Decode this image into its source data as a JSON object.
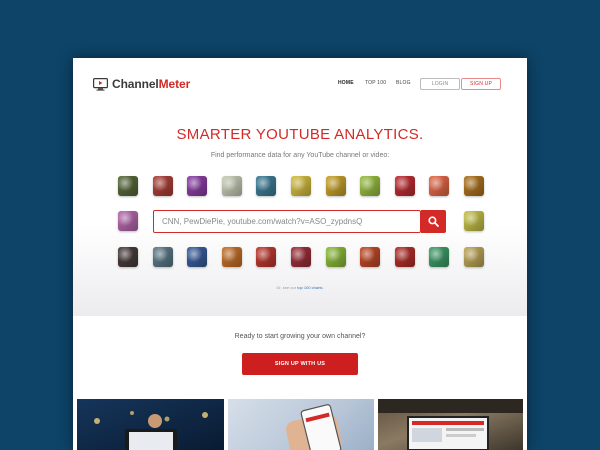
{
  "brand": {
    "name_part1": "Channel",
    "name_part2": "Meter"
  },
  "nav": {
    "home": "HOME",
    "top100": "TOP 100",
    "blog": "BLOG",
    "login": "LOGIN",
    "signup": "SIGN UP"
  },
  "hero": {
    "title": "SMARTER YOUTUBE ANALYTICS.",
    "subtitle": "Find performance data for any YouTube channel or video:",
    "search_placeholder": "CNN, PewDiePie, youtube.com/watch?v=ASO_zypdnsQ",
    "hint_prefix": "Or, see our ",
    "hint_link": "top 100 charts",
    "hint_suffix": "."
  },
  "cta": {
    "text": "Ready to start growing your own channel?",
    "button": "SIGN UP WITH US"
  },
  "colors": {
    "background": "#0d4468",
    "accent": "#d32a27",
    "nav_text": "#444444"
  },
  "icons": {
    "logo": "monitor-play-icon",
    "search": "search-icon"
  },
  "thumbnail_colors": {
    "row1": [
      "#5a6b3c",
      "#b0413a",
      "#8e3fa8",
      "#c9cfb8",
      "#3f7f9a",
      "#d7c040",
      "#caa52c",
      "#9bc142",
      "#c22e34",
      "#e86a4a",
      "#b0751f"
    ],
    "row2_left": [
      "#b86ab0"
    ],
    "row2_right": [
      "#c8c44a"
    ],
    "row3": [
      "#4a3e3e",
      "#5c7c8a",
      "#3a5fa0",
      "#c8732a",
      "#c23a30",
      "#a0303a",
      "#8dbf3a",
      "#c44a28",
      "#b6302a",
      "#3f9f6a",
      "#c0a85a"
    ]
  }
}
